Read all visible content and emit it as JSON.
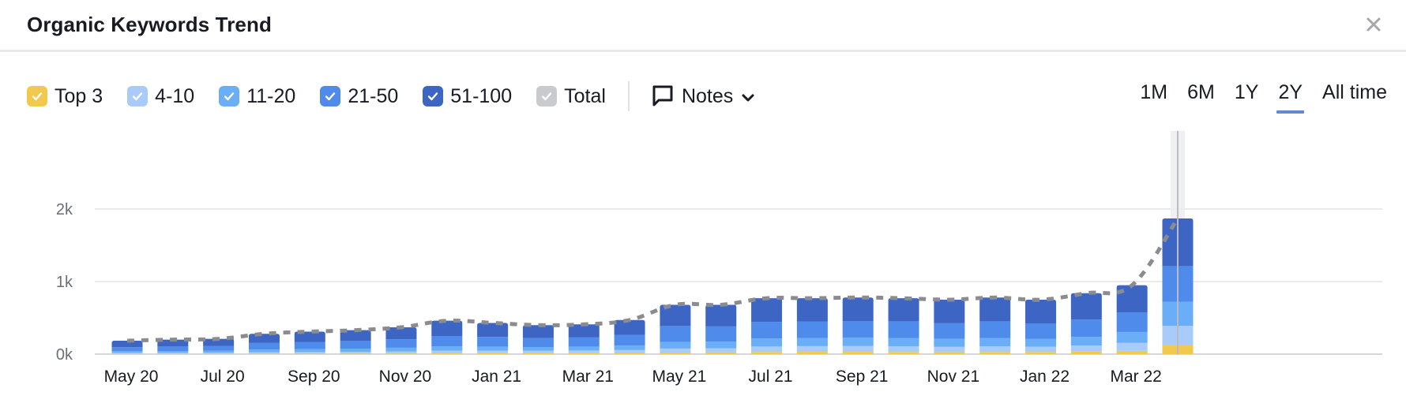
{
  "header": {
    "title": "Organic Keywords Trend",
    "close_icon": "close-icon"
  },
  "legend": {
    "items": [
      {
        "label": "Top 3",
        "color": "#f2c94c",
        "checked": true
      },
      {
        "label": "4-10",
        "color": "#a9cbf9",
        "checked": true
      },
      {
        "label": "11-20",
        "color": "#6aaef7",
        "checked": true
      },
      {
        "label": "21-50",
        "color": "#4f8bea",
        "checked": true
      },
      {
        "label": "51-100",
        "color": "#3d66c4",
        "checked": true
      },
      {
        "label": "Total",
        "color": "#c9cace",
        "checked": true
      }
    ],
    "notes_label": "Notes"
  },
  "periods": [
    {
      "label": "1M",
      "active": false
    },
    {
      "label": "6M",
      "active": false
    },
    {
      "label": "1Y",
      "active": false
    },
    {
      "label": "2Y",
      "active": true
    },
    {
      "label": "All time",
      "active": false
    }
  ],
  "chart_data": {
    "type": "bar",
    "stacked": true,
    "title": "Organic Keywords Trend",
    "xlabel": "",
    "ylabel": "",
    "ylim": [
      0,
      2000
    ],
    "yticks": [
      0,
      1000,
      2000
    ],
    "ytick_labels": [
      "0k",
      "1k",
      "2k"
    ],
    "grid": true,
    "legend_position": "top-left",
    "categories": [
      "May 20",
      "Jun 20",
      "Jul 20",
      "Aug 20",
      "Sep 20",
      "Oct 20",
      "Nov 20",
      "Dec 20",
      "Jan 21",
      "Feb 21",
      "Mar 21",
      "Apr 21",
      "May 21",
      "Jun 21",
      "Jul 21",
      "Aug 21",
      "Sep 21",
      "Oct 21",
      "Nov 21",
      "Dec 21",
      "Jan 22",
      "Feb 22",
      "Mar 22",
      "Apr 22"
    ],
    "xtick_labels": [
      "May 20",
      "Jul 20",
      "Sep 20",
      "Nov 20",
      "Jan 21",
      "Mar 21",
      "May 21",
      "Jul 21",
      "Sep 21",
      "Nov 21",
      "Jan 22",
      "Mar 22"
    ],
    "series": [
      {
        "name": "Top 3",
        "color": "#f2c94c",
        "values": [
          3,
          3,
          4,
          5,
          5,
          6,
          8,
          10,
          12,
          12,
          14,
          16,
          22,
          25,
          30,
          32,
          32,
          30,
          28,
          30,
          30,
          35,
          45,
          120
        ]
      },
      {
        "name": "4-10",
        "color": "#a9cbf9",
        "values": [
          15,
          15,
          16,
          22,
          24,
          26,
          30,
          38,
          36,
          34,
          36,
          40,
          55,
          55,
          75,
          78,
          80,
          78,
          72,
          78,
          72,
          82,
          110,
          270
        ]
      },
      {
        "name": "11-20",
        "color": "#6aaef7",
        "values": [
          22,
          25,
          26,
          36,
          40,
          44,
          50,
          60,
          56,
          52,
          54,
          62,
          90,
          92,
          110,
          112,
          115,
          115,
          110,
          115,
          110,
          120,
          150,
          330
        ]
      },
      {
        "name": "21-50",
        "color": "#4f8bea",
        "values": [
          55,
          62,
          64,
          90,
          100,
          105,
          118,
          142,
          132,
          122,
          126,
          148,
          220,
          210,
          230,
          225,
          225,
          225,
          215,
          225,
          212,
          240,
          270,
          490
        ]
      },
      {
        "name": "51-100",
        "color": "#3d66c4",
        "values": [
          90,
          95,
          100,
          127,
          141,
          149,
          164,
          210,
          194,
          180,
          180,
          204,
          293,
          298,
          325,
          323,
          328,
          322,
          325,
          332,
          326,
          363,
          375,
          660
        ]
      }
    ],
    "total": {
      "name": "Total",
      "color": "#8a8c92",
      "style": "dashed",
      "values": [
        185,
        200,
        210,
        280,
        310,
        330,
        370,
        460,
        430,
        400,
        410,
        470,
        680,
        680,
        770,
        770,
        780,
        770,
        750,
        780,
        750,
        840,
        950,
        1870
      ]
    }
  }
}
